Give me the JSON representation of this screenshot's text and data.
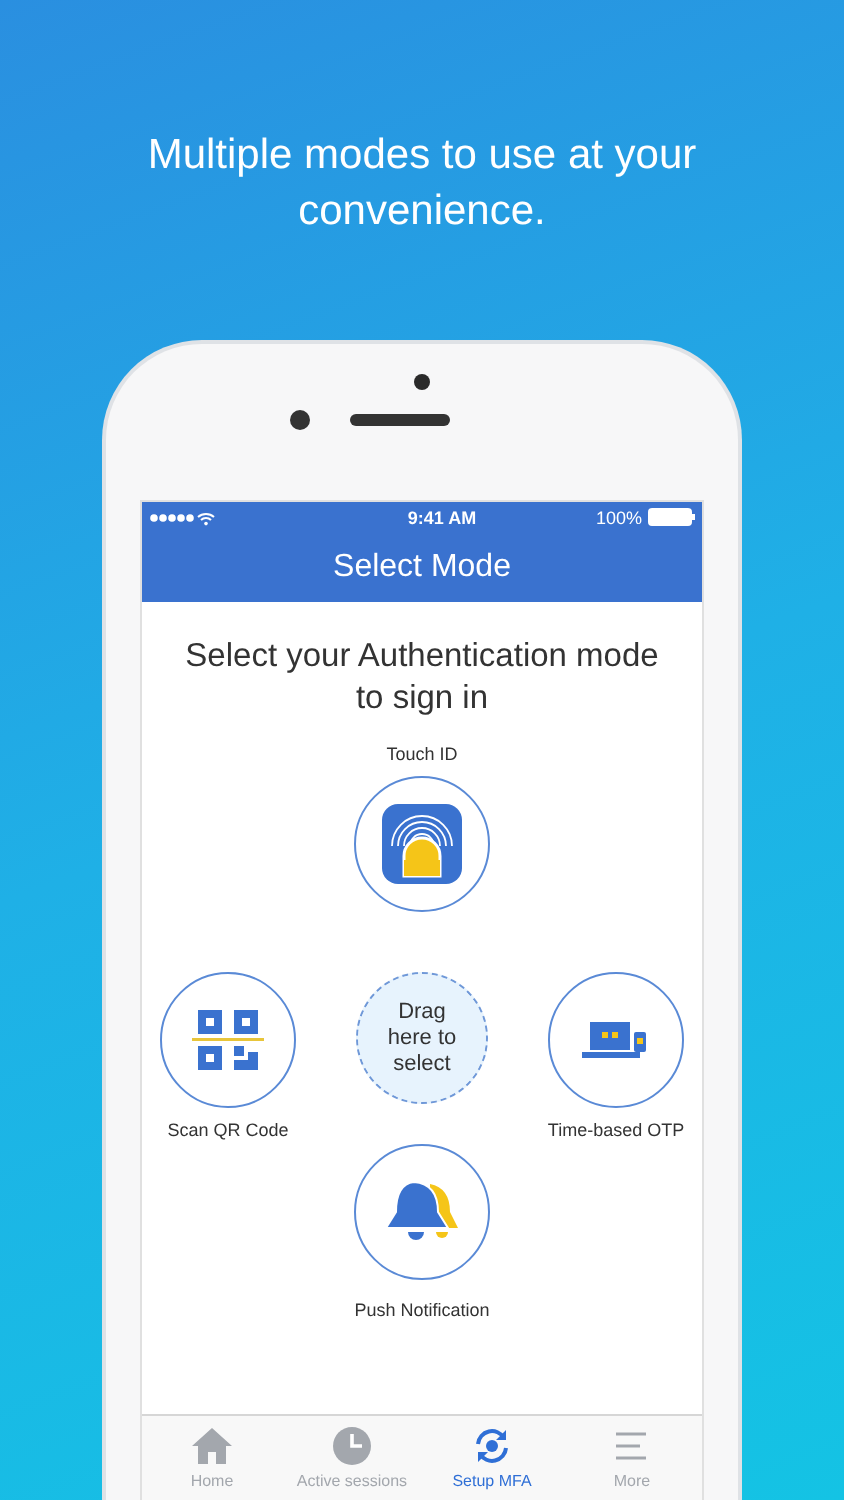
{
  "headline": "Multiple modes to use at your convenience.",
  "status_bar": {
    "time": "9:41 AM",
    "battery": "100%"
  },
  "nav_title": "Select Mode",
  "prompt": "Select your Authentication mode to sign in",
  "modes": [
    {
      "kind": "touch_id",
      "label": "Touch ID"
    },
    {
      "kind": "qr",
      "label": "Scan QR Code"
    },
    {
      "kind": "otp",
      "label": "Time-based OTP"
    },
    {
      "kind": "push",
      "label": "Push Notification"
    }
  ],
  "drop_zone": "Drag here to select",
  "tabs": [
    {
      "kind": "home",
      "label": "Home",
      "selected": false
    },
    {
      "kind": "clock",
      "label": "Active sessions",
      "selected": false
    },
    {
      "kind": "sync",
      "label": "Setup MFA",
      "selected": true
    },
    {
      "kind": "menu",
      "label": "More",
      "selected": false
    }
  ]
}
